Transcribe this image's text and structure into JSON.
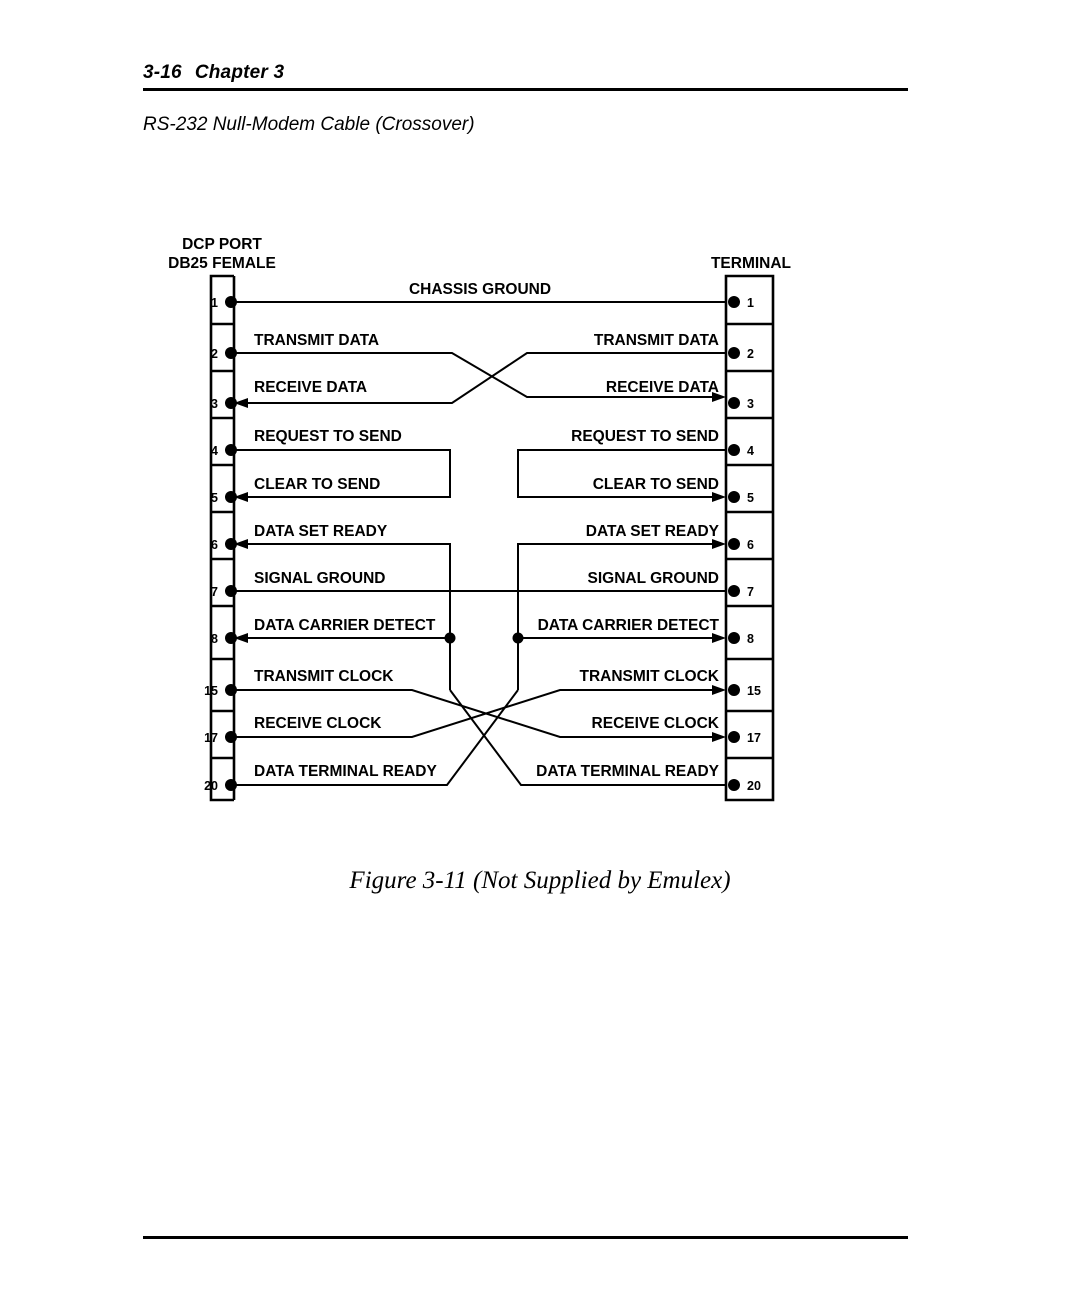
{
  "header": {
    "page_number": "3-16",
    "chapter": "Chapter 3"
  },
  "section": {
    "heading": "RS-232 Null-Modem Cable (Crossover)"
  },
  "figure": {
    "caption": "Figure 3-11 (Not Supplied by Emulex)",
    "left_connector": {
      "title_line1": "DCP PORT",
      "title_line2": "DB25 FEMALE"
    },
    "right_connector": {
      "title_line1": "TERMINAL"
    },
    "rows": [
      {
        "pin_left": "1",
        "pin_right": "1",
        "label_left": "CHASSIS GROUND",
        "label_right": "",
        "wiring": "straight-through"
      },
      {
        "pin_left": "2",
        "pin_right": "2",
        "label_left": "TRANSMIT DATA",
        "label_right": "TRANSMIT DATA",
        "wiring": "crossover-to-3"
      },
      {
        "pin_left": "3",
        "pin_right": "3",
        "label_left": "RECEIVE DATA",
        "label_right": "RECEIVE DATA",
        "wiring": "crossover-to-2"
      },
      {
        "pin_left": "4",
        "pin_right": "4",
        "label_left": "REQUEST TO SEND",
        "label_right": "REQUEST TO SEND",
        "wiring": "local-loopback-to-5"
      },
      {
        "pin_left": "5",
        "pin_right": "5",
        "label_left": "CLEAR TO SEND",
        "label_right": "CLEAR TO SEND",
        "wiring": "local-loopback-from-4"
      },
      {
        "pin_left": "6",
        "pin_right": "6",
        "label_left": "DATA SET READY",
        "label_right": "DATA SET READY",
        "wiring": "local-loopback-from-8-and-20"
      },
      {
        "pin_left": "7",
        "pin_right": "7",
        "label_left": "SIGNAL GROUND",
        "label_right": "SIGNAL GROUND",
        "wiring": "straight-through"
      },
      {
        "pin_left": "8",
        "pin_right": "8",
        "label_left": "DATA CARRIER DETECT",
        "label_right": "DATA CARRIER DETECT",
        "wiring": "junction-to-6-and-20"
      },
      {
        "pin_left": "15",
        "pin_right": "15",
        "label_left": "TRANSMIT CLOCK",
        "label_right": "TRANSMIT CLOCK",
        "wiring": "crossover-to-17"
      },
      {
        "pin_left": "17",
        "pin_right": "17",
        "label_left": "RECEIVE CLOCK",
        "label_right": "RECEIVE CLOCK",
        "wiring": "crossover-to-15"
      },
      {
        "pin_left": "20",
        "pin_right": "20",
        "label_left": "DATA TERMINAL READY",
        "label_right": "DATA TERMINAL READY",
        "wiring": "crossover-to-opposite-6-8"
      }
    ]
  },
  "colors": {
    "ink": "#000000",
    "paper": "#ffffff"
  }
}
